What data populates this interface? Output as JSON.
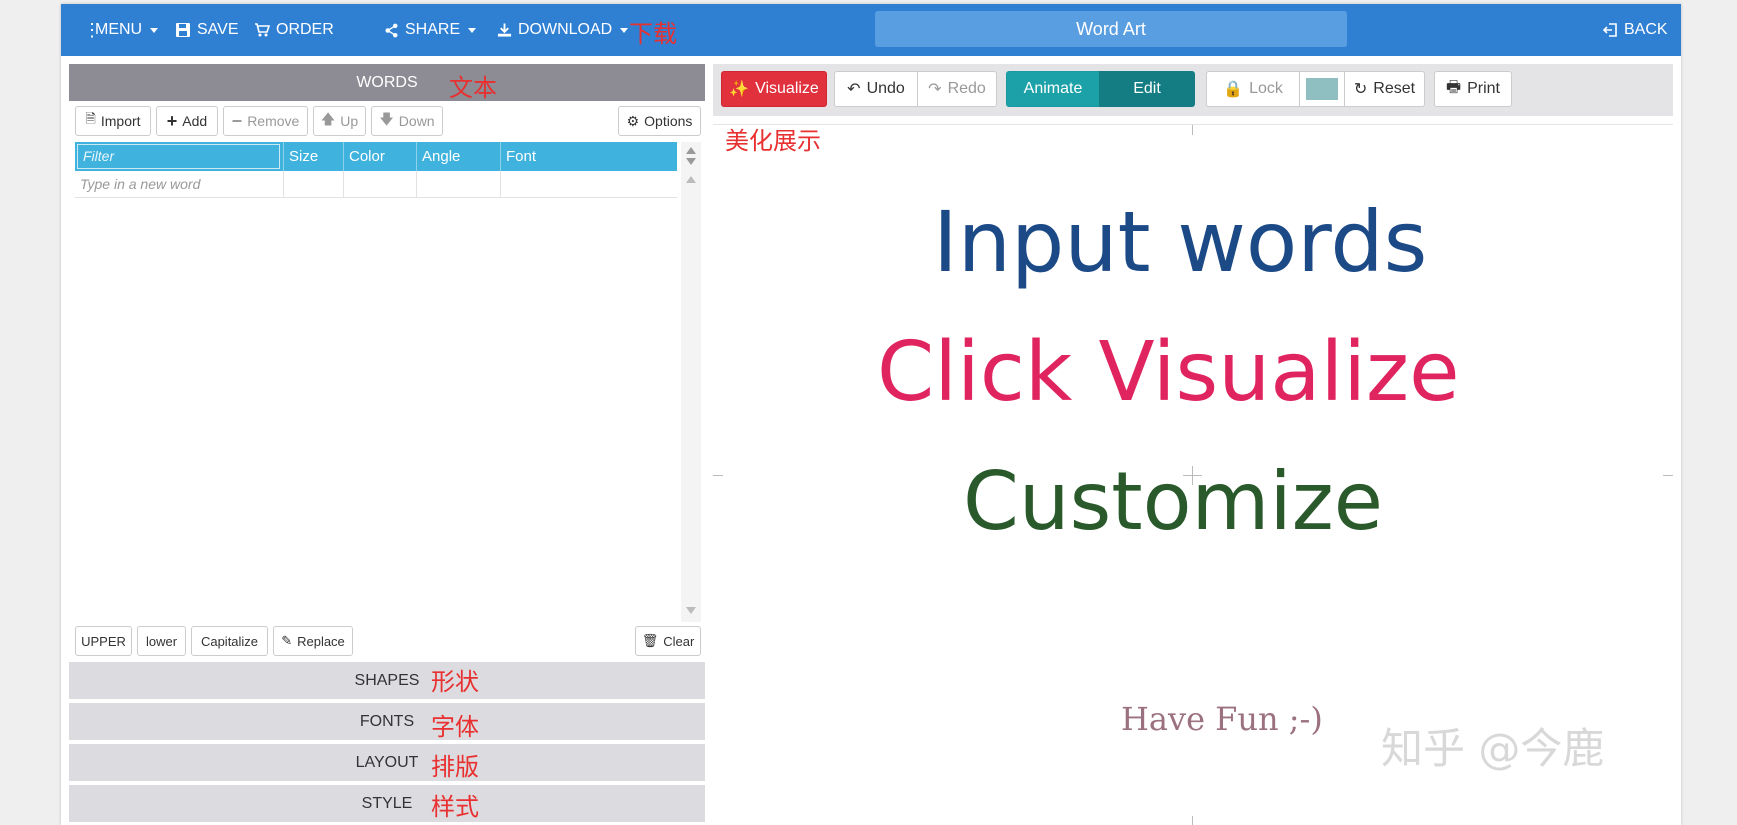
{
  "topbar": {
    "menu": "MENU",
    "save": "SAVE",
    "order": "ORDER",
    "share": "SHARE",
    "download": "DOWNLOAD",
    "title": "Word Art",
    "back": "BACK",
    "download_annotation": "下载"
  },
  "words_panel": {
    "header": "WORDS",
    "header_annotation": "文本",
    "buttons": {
      "import": "Import",
      "add": "Add",
      "remove": "Remove",
      "up": "Up",
      "down": "Down",
      "options": "Options"
    },
    "grid": {
      "filter_placeholder": "Filter",
      "columns": [
        "Size",
        "Color",
        "Angle",
        "Font"
      ],
      "new_word_placeholder": "Type in a new word"
    },
    "bottom_buttons": {
      "upper": "UPPER",
      "lower": "lower",
      "capitalize": "Capitalize",
      "replace": "Replace",
      "clear": "Clear"
    }
  },
  "sections": [
    {
      "label": "SHAPES",
      "annotation": "形状"
    },
    {
      "label": "FONTS",
      "annotation": "字体"
    },
    {
      "label": "LAYOUT",
      "annotation": "排版"
    },
    {
      "label": "STYLE",
      "annotation": "样式"
    }
  ],
  "toolbar": {
    "visualize": "Visualize",
    "undo": "Undo",
    "redo": "Redo",
    "animate": "Animate",
    "edit": "Edit",
    "lock": "Lock",
    "swatch_color": "#8fbfc1",
    "reset": "Reset",
    "print": "Print",
    "annotation": "美化展示"
  },
  "canvas": {
    "words": [
      {
        "text": "Input words",
        "color": "#1c4a87"
      },
      {
        "text": "Click Visualize",
        "color": "#e0245f"
      },
      {
        "text": "Customize",
        "color": "#2a5a2c"
      },
      {
        "text": "Have Fun ;-)",
        "color": "#9b7080"
      }
    ],
    "watermark": "知乎 @今鹿"
  },
  "colors": {
    "topbar": "#2f7fd3",
    "grid_header": "#3fb2de",
    "visualize": "#e0313d",
    "animate": "#1ca1a8"
  }
}
